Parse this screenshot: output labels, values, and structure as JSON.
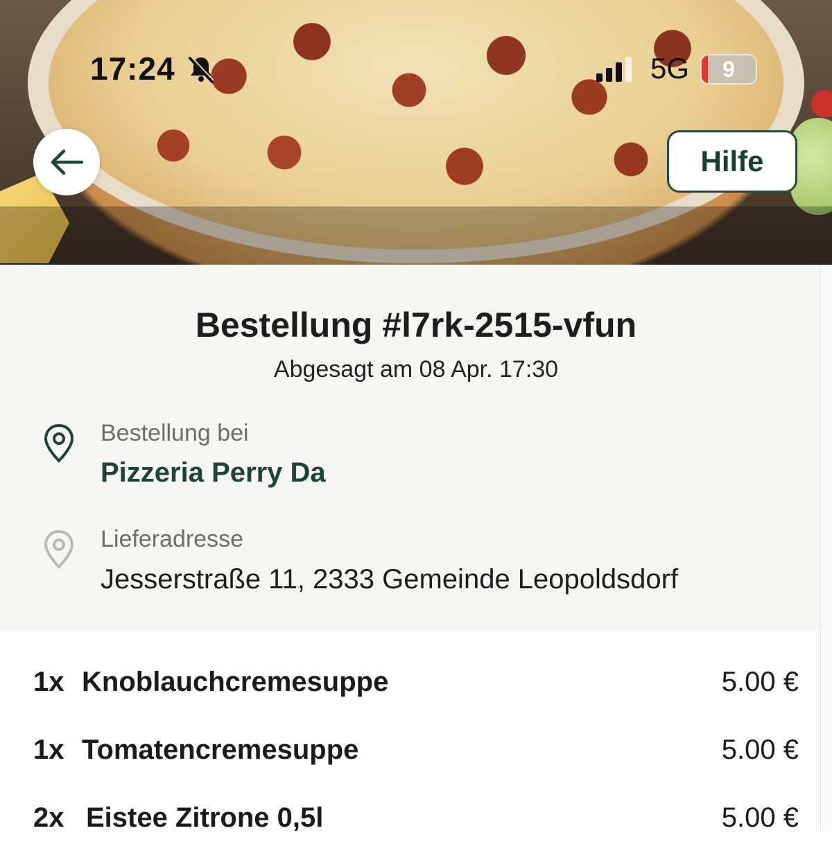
{
  "status_bar": {
    "time": "17:24",
    "network": "5G",
    "battery": "9",
    "icons": [
      "bell-muted-icon",
      "signal-icon",
      "battery-icon"
    ]
  },
  "header": {
    "back_icon": "arrow-left-icon",
    "help_label": "Hilfe"
  },
  "order": {
    "title": "Bestellung #l7rk-2515-vfun",
    "status": "Abgesagt am 08 Apr. 17:30"
  },
  "restaurant": {
    "label": "Bestellung bei",
    "name": "Pizzeria Perry Da",
    "icon": "location-pin-icon"
  },
  "delivery": {
    "label": "Lieferadresse",
    "address": "Jesserstraße 11, 2333 Gemeinde Leopoldsdorf",
    "icon": "location-pin-icon"
  },
  "items": [
    {
      "qty": "1x",
      "name": "Knoblauchcremesuppe",
      "price": "5.00 €"
    },
    {
      "qty": "1x",
      "name": "Tomatencremesuppe",
      "price": "5.00 €"
    },
    {
      "qty": "2x",
      "name": "Eistee Zitrone 0,5l",
      "price": "5.00 €"
    }
  ],
  "colors": {
    "accent": "#1b4536",
    "panel_bg": "#f7f6f2",
    "battery_low": "#e0372b"
  }
}
